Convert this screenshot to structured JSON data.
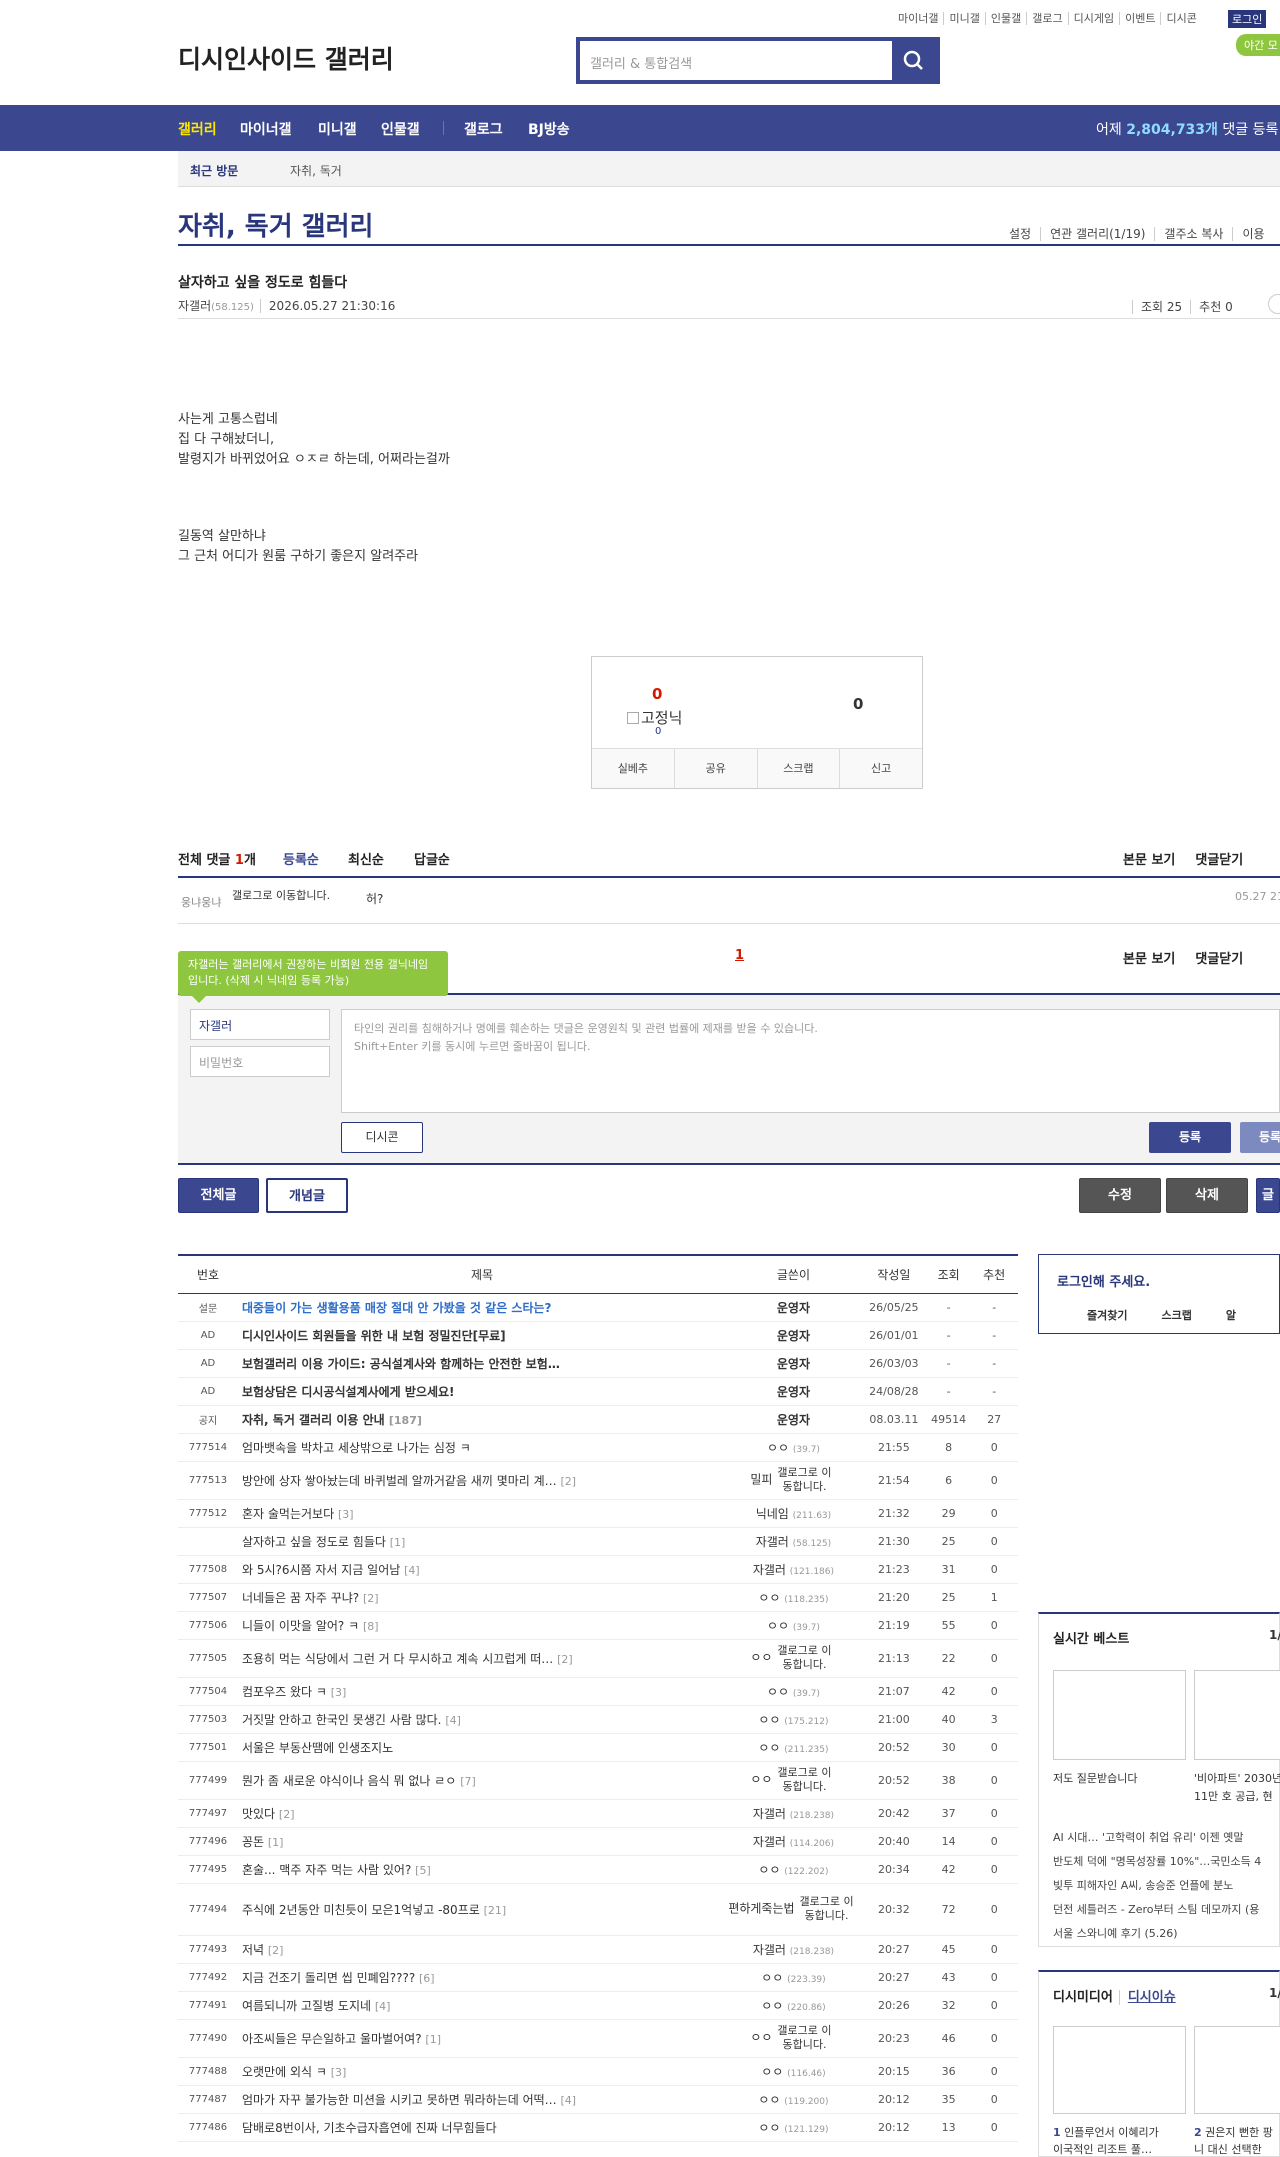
{
  "top": {
    "links": [
      "마이너갤",
      "미니갤",
      "인물갤",
      "갤로그",
      "디시게임",
      "이벤트",
      "디시콘"
    ],
    "login": "로그인",
    "night": "야간 모"
  },
  "logo": "디시인사이드 갤러리",
  "search": {
    "placeholder": "갤러리 & 통합검색"
  },
  "gnb": {
    "items": [
      "갤러리",
      "마이너갤",
      "미니갤",
      "인물갤",
      "갤로그",
      "BJ방송"
    ],
    "stat_prefix": "어제 ",
    "stat_value": "2,804,733개",
    "stat_suffix": " 댓글 등록"
  },
  "recent": {
    "label": "최근 방문",
    "value": "자취, 독거"
  },
  "gallery": {
    "title": "자취, 독거 갤러리",
    "menu": [
      "설정",
      "연관 갤러리(1/19)",
      "갤주소 복사",
      "이용"
    ]
  },
  "post": {
    "title": "살자하고 싶을 정도로 힘들다",
    "writer": "자갤러",
    "ip": "(58.125)",
    "date": "2026.05.27 21:30:16",
    "views": "조회 25",
    "recommend": "추천 0",
    "body1": "사는게 고통스럽네\n집 다 구해놨더니,\n발령지가 바뀌었어요 ㅇㅈㄹ 하는데, 어쩌라는걸까",
    "body2": "길동역 살만하냐\n그 근처 어디가 원룸 구하기 좋은지 알려주라"
  },
  "vote": {
    "up": "0",
    "fixed_nick": "고정닉",
    "fixed_count": "0",
    "down": "0",
    "buttons": [
      "실베추",
      "공유",
      "스크랩",
      "신고"
    ]
  },
  "comments": {
    "total_label": "전체 댓글",
    "total_count": "1",
    "total_unit": "개",
    "sorts": [
      "등록순",
      "최신순",
      "답글순"
    ],
    "view_post": "본문 보기",
    "close": "댓글닫기",
    "items": [
      {
        "name": "웅냐웅냐",
        "gallog": "갤로그로 이동합니다.",
        "text": "허?",
        "date": "05.27 21"
      }
    ],
    "page": "1"
  },
  "write": {
    "tip": "자갤러는 갤러리에서 권장하는 비회원 전용 갤닉네임입니다. (삭제 시 닉네임 등록 가능)",
    "nick": "자갤러",
    "password_placeholder": "비밀번호",
    "textarea_placeholder": "타인의 권리를 침해하거나 명예를 훼손하는 댓글은 운영원칙 및 관련 법률에 제재를 받을 수 있습니다.\nShift+Enter 키를 동시에 누르면 줄바꿈이 됩니다.",
    "dccon": "디시콘",
    "submit": "등록",
    "submit2": "등록"
  },
  "actions": {
    "all": "전체글",
    "concept": "개념글",
    "edit": "수정",
    "delete": "삭제",
    "write": "글"
  },
  "list": {
    "headers": [
      "번호",
      "제목",
      "글쓴이",
      "작성일",
      "조회",
      "추천"
    ],
    "rows": [
      {
        "num": "설문",
        "title": "대중들이 가는 생활용품 매장 절대 안 가봤을 것 같은 스타는?",
        "reply": "",
        "writer": "운영자",
        "ip": "",
        "date": "26/05/25",
        "views": "-",
        "rec": "-",
        "type": "survey"
      },
      {
        "num": "AD",
        "title": "디시인사이드 회원들을 위한 내 보험 정밀진단[무료]",
        "reply": "",
        "writer": "운영자",
        "ip": "",
        "date": "26/01/01",
        "views": "-",
        "rec": "-",
        "type": "notice"
      },
      {
        "num": "AD",
        "title": "보험갤러리 이용 가이드: 공식설계사와 함께하는 안전한 보험…",
        "reply": "",
        "writer": "운영자",
        "ip": "",
        "date": "26/03/03",
        "views": "-",
        "rec": "-",
        "type": "notice"
      },
      {
        "num": "AD",
        "title": "보험상담은 디시공식설계사에게 받으세요!",
        "reply": "",
        "writer": "운영자",
        "ip": "",
        "date": "24/08/28",
        "views": "-",
        "rec": "-",
        "type": "notice"
      },
      {
        "num": "공지",
        "title": "자취, 독거 갤러리 이용 안내",
        "reply": "[187]",
        "writer": "운영자",
        "ip": "",
        "date": "08.03.11",
        "views": "49514",
        "rec": "27",
        "type": "notice"
      },
      {
        "num": "777514",
        "title": "엄마뱃속을 박차고 세상밖으로 나가는 심정 ㅋ",
        "reply": "",
        "writer": "ㅇㅇ",
        "ip": "(39.7)",
        "date": "21:55",
        "views": "8",
        "rec": "0",
        "type": ""
      },
      {
        "num": "777513",
        "title": "방안에 상자 쌓아놨는데 바퀴벌레 알까거같음 새끼 몇마리 계…",
        "reply": "[2]",
        "writer": "밀피",
        "ip": "",
        "gallog": "갤로그로 이동합니다.",
        "date": "21:54",
        "views": "6",
        "rec": "0",
        "type": "tall"
      },
      {
        "num": "777512",
        "title": "혼자 술먹는거보다",
        "reply": "[3]",
        "writer": "닉네임",
        "ip": "(211.63)",
        "date": "21:32",
        "views": "29",
        "rec": "0",
        "type": ""
      },
      {
        "num": "",
        "title": "살자하고 싶을 정도로 힘들다",
        "reply": "[1]",
        "writer": "자갤러",
        "ip": "(58.125)",
        "date": "21:30",
        "views": "25",
        "rec": "0",
        "type": ""
      },
      {
        "num": "777508",
        "title": "와 5시?6시쯤 자서 지금 일어남",
        "reply": "[4]",
        "writer": "자갤러",
        "ip": "(121.186)",
        "date": "21:23",
        "views": "31",
        "rec": "0",
        "type": ""
      },
      {
        "num": "777507",
        "title": "너네들은 꿈 자주 꾸냐?",
        "reply": "[2]",
        "writer": "ㅇㅇ",
        "ip": "(118.235)",
        "date": "21:20",
        "views": "25",
        "rec": "1",
        "type": ""
      },
      {
        "num": "777506",
        "title": "니들이 이맛을 알어? ㅋ",
        "reply": "[8]",
        "writer": "ㅇㅇ",
        "ip": "(39.7)",
        "date": "21:19",
        "views": "55",
        "rec": "0",
        "type": ""
      },
      {
        "num": "777505",
        "title": "조용히 먹는 식당에서 그런 거 다 무시하고 계속 시끄럽게 떠…",
        "reply": "[2]",
        "writer": "ㅇㅇ",
        "ip": "",
        "gallog": "갤로그로 이동합니다.",
        "date": "21:13",
        "views": "22",
        "rec": "0",
        "type": "tall"
      },
      {
        "num": "777504",
        "title": "컴포우즈 왔다 ㅋ",
        "reply": "[3]",
        "writer": "ㅇㅇ",
        "ip": "(39.7)",
        "date": "21:07",
        "views": "42",
        "rec": "0",
        "type": ""
      },
      {
        "num": "777503",
        "title": "거짓말 안하고 한국인 못생긴 사람 많다.",
        "reply": "[4]",
        "writer": "ㅇㅇ",
        "ip": "(175.212)",
        "date": "21:00",
        "views": "40",
        "rec": "3",
        "type": ""
      },
      {
        "num": "777501",
        "title": "서울은 부동산땜에 인생조지노",
        "reply": "",
        "writer": "ㅇㅇ",
        "ip": "(211.235)",
        "date": "20:52",
        "views": "30",
        "rec": "0",
        "type": ""
      },
      {
        "num": "777499",
        "title": "뭔가 좀 새로운 야식이나 음식 뭐 없나 ㄹㅇ",
        "reply": "[7]",
        "writer": "ㅇㅇ",
        "ip": "",
        "gallog": "갤로그로 이동합니다.",
        "date": "20:52",
        "views": "38",
        "rec": "0",
        "type": "tall"
      },
      {
        "num": "777497",
        "title": "맛있다",
        "reply": "[2]",
        "writer": "자갤러",
        "ip": "(218.238)",
        "date": "20:42",
        "views": "37",
        "rec": "0",
        "type": ""
      },
      {
        "num": "777496",
        "title": "꽁돈",
        "reply": "[1]",
        "writer": "자갤러",
        "ip": "(114.206)",
        "date": "20:40",
        "views": "14",
        "rec": "0",
        "type": ""
      },
      {
        "num": "777495",
        "title": "혼술... 맥주 자주 먹는 사람 있어?",
        "reply": "[5]",
        "writer": "ㅇㅇ",
        "ip": "(122.202)",
        "date": "20:34",
        "views": "42",
        "rec": "0",
        "type": ""
      },
      {
        "num": "777494",
        "title": "주식에 2년동안 미친듯이 모은1억넣고 -80프로",
        "reply": "[21]",
        "writer": "편하게죽는법",
        "ip": "",
        "gallog": "갤로그로 이동합니다.",
        "date": "20:32",
        "views": "72",
        "rec": "0",
        "type": "tall2"
      },
      {
        "num": "777493",
        "title": "저녁",
        "reply": "[2]",
        "writer": "자갤러",
        "ip": "(218.238)",
        "date": "20:27",
        "views": "45",
        "rec": "0",
        "type": ""
      },
      {
        "num": "777492",
        "title": "지금 건조기 돌리면 씹 민폐임????",
        "reply": "[6]",
        "writer": "ㅇㅇ",
        "ip": "(223.39)",
        "date": "20:27",
        "views": "43",
        "rec": "0",
        "type": ""
      },
      {
        "num": "777491",
        "title": "여름되니까 고질병 도지네",
        "reply": "[4]",
        "writer": "ㅇㅇ",
        "ip": "(220.86)",
        "date": "20:26",
        "views": "32",
        "rec": "0",
        "type": ""
      },
      {
        "num": "777490",
        "title": "아조씨들은 무슨일하고 울마벌어여?",
        "reply": "[1]",
        "writer": "ㅇㅇ",
        "ip": "",
        "gallog": "갤로그로 이동합니다.",
        "date": "20:23",
        "views": "46",
        "rec": "0",
        "type": "tall"
      },
      {
        "num": "777488",
        "title": "오랫만에 외식 ㅋ",
        "reply": "[3]",
        "writer": "ㅇㅇ",
        "ip": "(116.46)",
        "date": "20:15",
        "views": "36",
        "rec": "0",
        "type": ""
      },
      {
        "num": "777487",
        "title": "엄마가 자꾸 불가능한 미션을 시키고 못하면 뭐라하는데 어떡…",
        "reply": "[4]",
        "writer": "ㅇㅇ",
        "ip": "(119.200)",
        "date": "20:12",
        "views": "35",
        "rec": "0",
        "type": ""
      },
      {
        "num": "777486",
        "title": "담배로8번이사, 기초수급자흡연에 진짜 너무힘들다",
        "reply": "",
        "writer": "ㅇㅇ",
        "ip": "(121.129)",
        "date": "20:12",
        "views": "13",
        "rec": "0",
        "type": ""
      }
    ]
  },
  "side": {
    "login_title": "로그인해 주세요.",
    "login_menu": [
      "즐겨찾기",
      "스크랩",
      "알"
    ],
    "best_title": "실시간 베스트",
    "best_page": "1/",
    "best_caps": [
      "저도 질문받습니다",
      "'비아파트' 2030년\n11만 호 공급, 현"
    ],
    "best_list": [
      "AI 시대… '고학력이 취업 유리' 이젠 옛말",
      "반도체 덕에 \"명목성장률 10%\"…국민소득 4",
      "빚투 피해자인 A씨, 송승준 언플에 분노",
      "던전 세틀러즈 - Zero부터 스팀 데모까지 (용",
      "서울 스와니예 후기 (5.26)"
    ],
    "media_title": "디시미디어",
    "media_link": "디시이슈",
    "media_page": "1/",
    "media_caps": [
      {
        "n": "1",
        "t": "인플루언서 이혜리가\n이국적인 리조트 풀…"
      },
      {
        "n": "2",
        "t": "권은지 뻔한 팡\n니 대신 선택한"
      }
    ]
  }
}
